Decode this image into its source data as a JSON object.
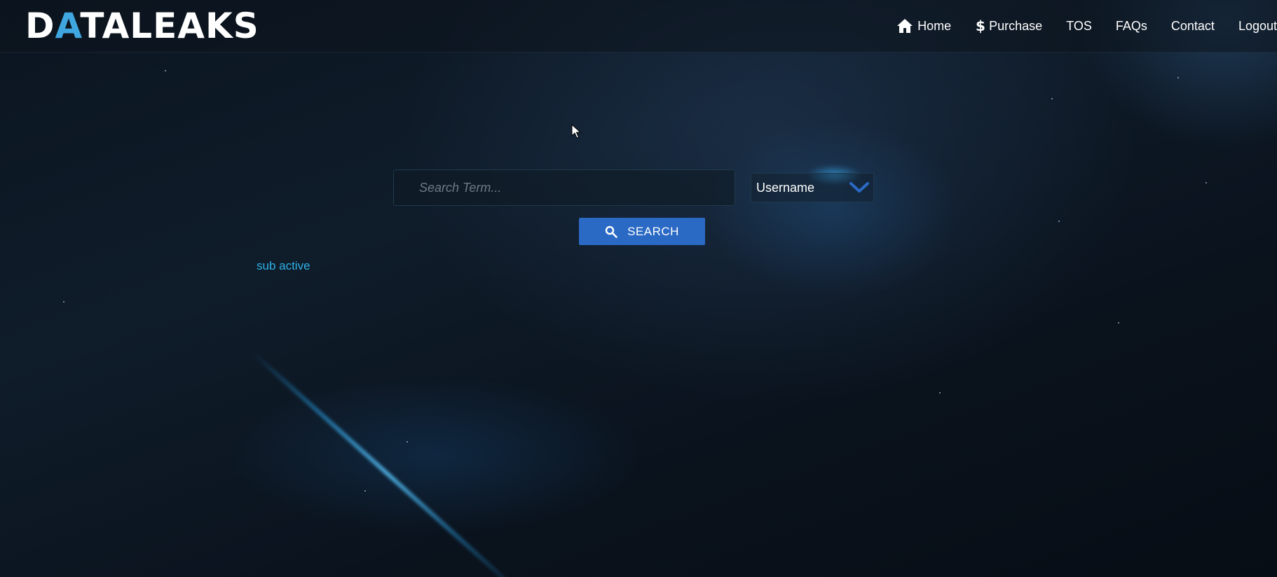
{
  "logo": {
    "text_part1": "D",
    "text_accent": "A",
    "text_part2": "TALEAKS"
  },
  "nav": {
    "items": [
      {
        "label": "Home",
        "icon": "home-icon"
      },
      {
        "label": "Purchase",
        "icon": "dollar-icon"
      },
      {
        "label": "TOS"
      },
      {
        "label": "FAQs"
      },
      {
        "label": "Contact"
      },
      {
        "label": "Logout"
      }
    ]
  },
  "search": {
    "placeholder": "Search Term...",
    "value": "",
    "type_selected": "Username",
    "button_label": "SEARCH"
  },
  "status": {
    "text": "sub active"
  },
  "colors": {
    "accent": "#2a69c4",
    "status": "#2fb1e6",
    "background": "#0b1520"
  }
}
